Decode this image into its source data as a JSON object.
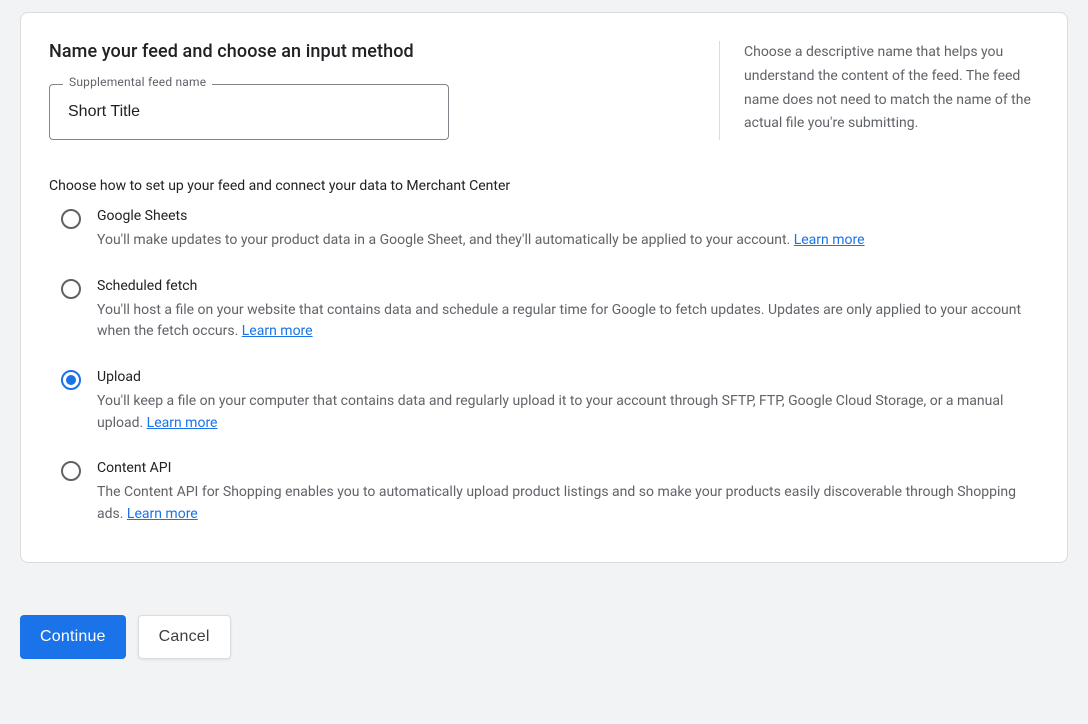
{
  "heading": "Name your feed and choose an input method",
  "feed_name": {
    "label": "Supplemental feed name",
    "value": "Short Title"
  },
  "help_text": "Choose a descriptive name that helps you understand the content of the feed. The feed name does not need to match the name of the actual file you're submitting.",
  "subheading": "Choose how to set up your feed and connect your data to Merchant Center",
  "options": [
    {
      "id": "google-sheets",
      "title": "Google Sheets",
      "desc": "You'll make updates to your product data in a Google Sheet, and they'll automatically be applied to your account. ",
      "learn": "Learn more",
      "selected": false
    },
    {
      "id": "scheduled-fetch",
      "title": "Scheduled fetch",
      "desc": "You'll host a file on your website that contains data and schedule a regular time for Google to fetch updates. Updates are only applied to your account when the fetch occurs. ",
      "learn": "Learn more",
      "selected": false
    },
    {
      "id": "upload",
      "title": "Upload",
      "desc": "You'll keep a file on your computer that contains data and regularly upload it to your account through SFTP, FTP, Google Cloud Storage, or a manual upload. ",
      "learn": "Learn more",
      "selected": true
    },
    {
      "id": "content-api",
      "title": "Content API",
      "desc": "The Content API for Shopping enables you to automatically upload product listings and so make your products easily discoverable through Shopping ads. ",
      "learn": "Learn more",
      "selected": false
    }
  ],
  "buttons": {
    "continue": "Continue",
    "cancel": "Cancel"
  }
}
